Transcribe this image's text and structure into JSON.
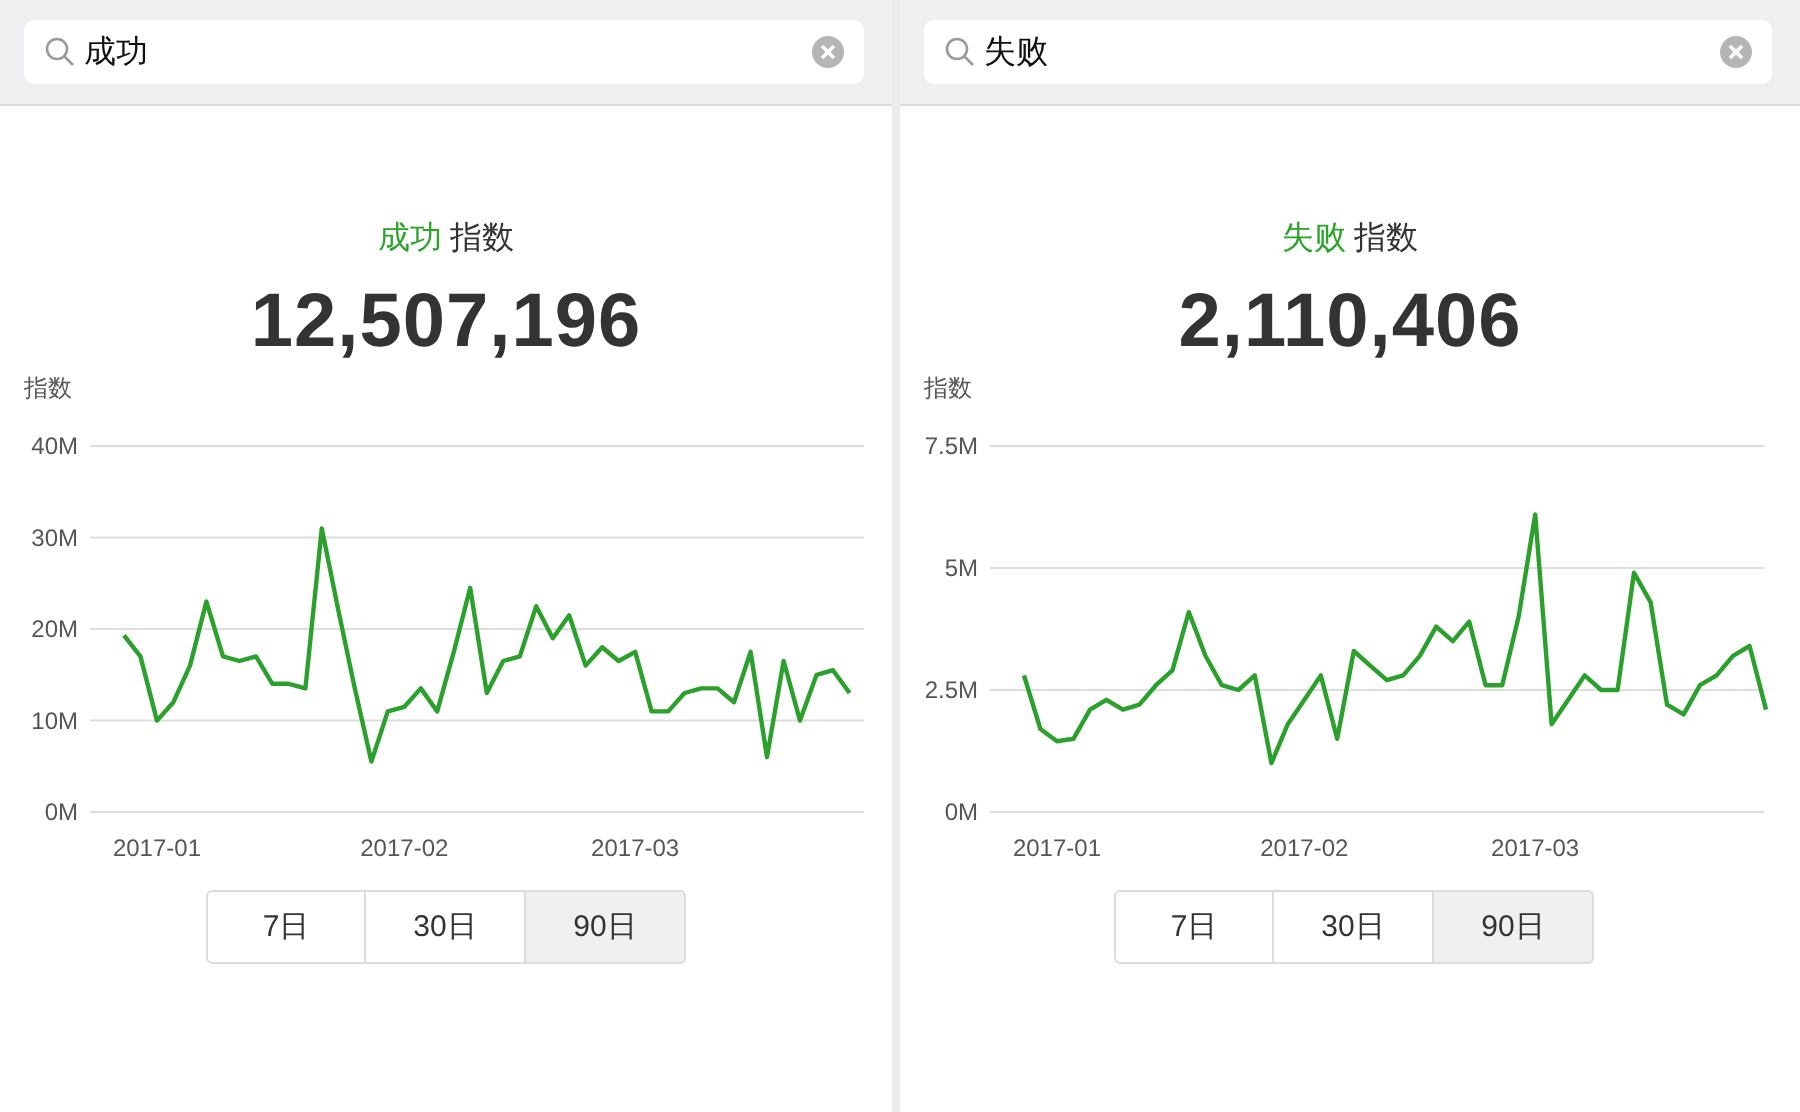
{
  "panels": [
    {
      "search": {
        "value": "成功"
      },
      "heading": {
        "term": "成功",
        "suffix": "指数"
      },
      "total": "12,507,196",
      "chart": {
        "chart_data": {
          "type": "line",
          "ylabel": "指数",
          "categories": [
            null,
            null,
            "2017-01",
            null,
            null,
            null,
            null,
            null,
            null,
            null,
            null,
            null,
            null,
            null,
            null,
            null,
            null,
            "2017-02",
            null,
            null,
            null,
            null,
            null,
            null,
            null,
            null,
            null,
            null,
            null,
            null,
            null,
            "2017-03",
            null,
            null,
            null,
            null,
            null,
            null,
            null,
            null,
            null,
            null,
            null,
            null,
            null
          ],
          "series": [
            {
              "color": "#2ca02c",
              "values": [
                19.3,
                17,
                10,
                12,
                16,
                23,
                17,
                16.5,
                17,
                14,
                14,
                13.5,
                31,
                22,
                13.5,
                5.5,
                11,
                11.5,
                13.5,
                11,
                17.5,
                24.5,
                13,
                16.5,
                17,
                22.5,
                19,
                21.5,
                16,
                18,
                16.5,
                17.5,
                11,
                11,
                13,
                13.5,
                13.5,
                12,
                17.5,
                6,
                16.5,
                10,
                15,
                15.5,
                13
              ]
            }
          ],
          "grid": true,
          "ylim": [
            0,
            40
          ],
          "yticks": [
            {
              "value": 0,
              "label": "0M"
            },
            {
              "value": 10,
              "label": "10M"
            },
            {
              "value": 20,
              "label": "20M"
            },
            {
              "value": 30,
              "label": "30M"
            },
            {
              "value": 40,
              "label": "40M"
            }
          ]
        }
      },
      "ranges": [
        {
          "label": "7日",
          "selected": false
        },
        {
          "label": "30日",
          "selected": false
        },
        {
          "label": "90日",
          "selected": true
        }
      ]
    },
    {
      "search": {
        "value": "失败"
      },
      "heading": {
        "term": "失败",
        "suffix": "指数"
      },
      "total": "2,110,406",
      "chart": {
        "chart_data": {
          "type": "line",
          "ylabel": "指数",
          "categories": [
            null,
            null,
            "2017-01",
            null,
            null,
            null,
            null,
            null,
            null,
            null,
            null,
            null,
            null,
            null,
            null,
            null,
            null,
            "2017-02",
            null,
            null,
            null,
            null,
            null,
            null,
            null,
            null,
            null,
            null,
            null,
            null,
            null,
            "2017-03",
            null,
            null,
            null,
            null,
            null,
            null,
            null,
            null,
            null,
            null,
            null,
            null,
            null,
            null
          ],
          "series": [
            {
              "color": "#2ca02c",
              "values": [
                2.8,
                1.7,
                1.45,
                1.5,
                2.1,
                2.3,
                2.1,
                2.2,
                2.6,
                2.9,
                4.1,
                3.2,
                2.6,
                2.5,
                2.8,
                1.0,
                1.8,
                2.3,
                2.8,
                1.5,
                3.3,
                3.0,
                2.7,
                2.8,
                3.2,
                3.8,
                3.5,
                3.9,
                2.6,
                2.6,
                4.0,
                6.1,
                1.8,
                2.3,
                2.8,
                2.5,
                2.5,
                4.9,
                4.3,
                2.2,
                2.0,
                2.6,
                2.8,
                3.2,
                3.4,
                2.1
              ]
            }
          ],
          "grid": true,
          "ylim": [
            0,
            7.5
          ],
          "yticks": [
            {
              "value": 0,
              "label": "0M"
            },
            {
              "value": 2.5,
              "label": "2.5M"
            },
            {
              "value": 5,
              "label": "5M"
            },
            {
              "value": 7.5,
              "label": "7.5M"
            }
          ]
        }
      },
      "ranges": [
        {
          "label": "7日",
          "selected": false
        },
        {
          "label": "30日",
          "selected": false
        },
        {
          "label": "90日",
          "selected": true
        }
      ]
    }
  ]
}
